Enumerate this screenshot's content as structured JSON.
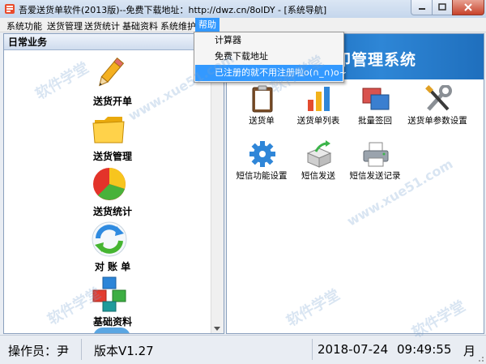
{
  "window": {
    "title": "吾爱送货单软件(2013版)--免费下载地址：http://dwz.cn/8olDY - [系统导航]"
  },
  "menu": {
    "items": [
      "系统功能",
      "送货管理",
      "送货统计",
      "基础资料",
      "系统维护",
      "帮助"
    ],
    "active_index": 5
  },
  "dropdown": {
    "items": [
      "计算器",
      "免费下载地址",
      "已注册的就不用注册啦o(∩_∩)o~"
    ],
    "selected_index": 2
  },
  "left_panel": {
    "header": "日常业务",
    "items": [
      {
        "label": "送货开单",
        "icon": "pencil-icon"
      },
      {
        "label": "送货管理",
        "icon": "folder-icon"
      },
      {
        "label": "送货统计",
        "icon": "pie-chart-icon"
      },
      {
        "label": "对 账 单",
        "icon": "refresh-arrows-icon"
      },
      {
        "label": "基础资料",
        "icon": "blocks-icon"
      }
    ]
  },
  "right_panel": {
    "banner_title": "印管理系统",
    "tiles": [
      {
        "label": "送货单",
        "icon": "clipboard-icon"
      },
      {
        "label": "送货单列表",
        "icon": "bar-chart-icon"
      },
      {
        "label": "批量签回",
        "icon": "windows-stack-icon"
      },
      {
        "label": "送货单参数设置",
        "icon": "tools-icon"
      },
      {
        "label": "短信功能设置",
        "icon": "gear-icon"
      },
      {
        "label": "短信发送",
        "icon": "send-box-icon"
      },
      {
        "label": "短信发送记录",
        "icon": "printer-icon"
      }
    ]
  },
  "status": {
    "operator": "操作员：尹",
    "version": "版本V1.27",
    "date": "2018-07-24",
    "time": "09:49:55",
    "day": "月"
  },
  "watermarks": [
    "软件学堂",
    "www.xue51.com"
  ]
}
